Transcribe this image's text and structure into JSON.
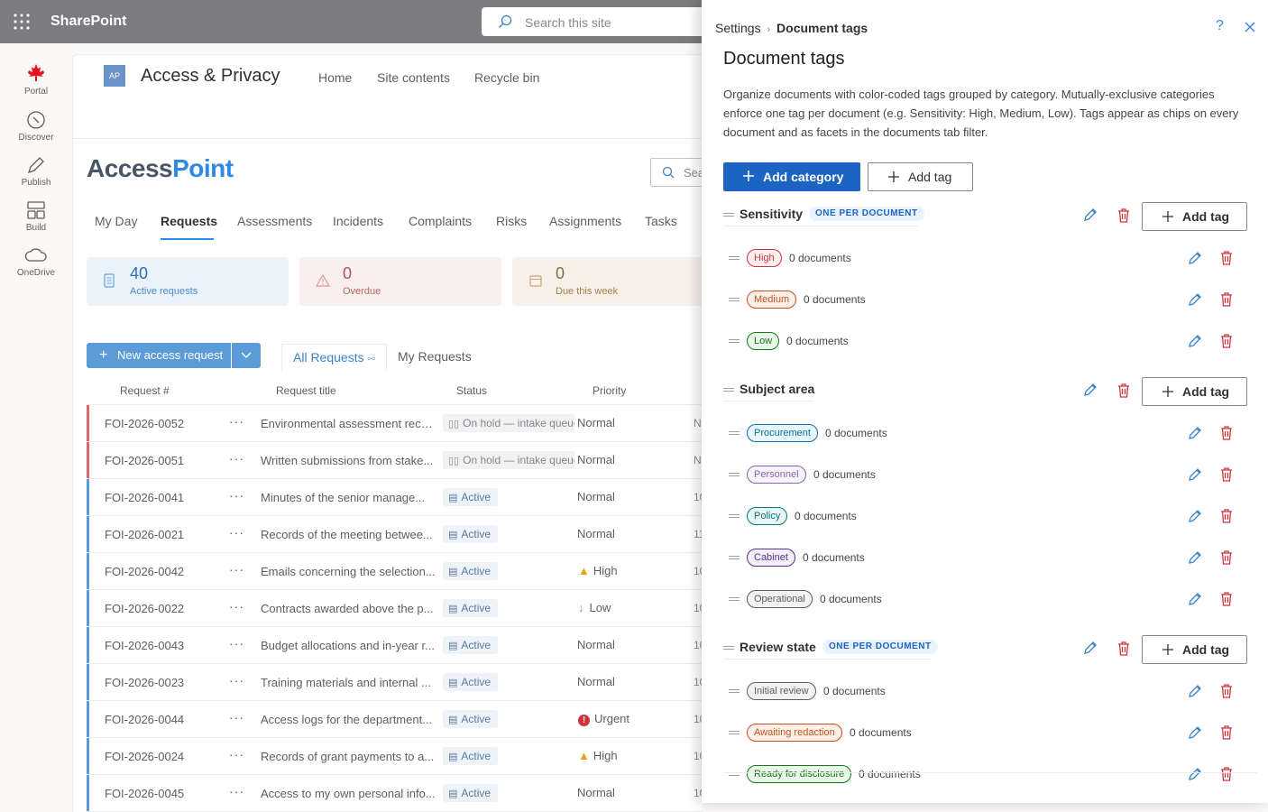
{
  "suite": {
    "brand": "SharePoint",
    "search_placeholder": "Search this site"
  },
  "rail": [
    {
      "label": "Portal",
      "icon": "maple-leaf-icon"
    },
    {
      "label": "Discover",
      "icon": "compass-icon"
    },
    {
      "label": "Publish",
      "icon": "pen-icon"
    },
    {
      "label": "Build",
      "icon": "grid-blocks-icon"
    },
    {
      "label": "OneDrive",
      "icon": "cloud-icon"
    }
  ],
  "site": {
    "logo_text": "AP",
    "name": "Access & Privacy",
    "nav": [
      "Home",
      "Site contents",
      "Recycle bin"
    ],
    "app_logo_a": "Access",
    "app_logo_b": "Point",
    "search_partial": "Sea"
  },
  "tabs": [
    "My Day",
    "Requests",
    "Assessments",
    "Incidents",
    "Complaints",
    "Risks",
    "Assignments",
    "Tasks"
  ],
  "cards": [
    {
      "num": "40",
      "label": "Active requests"
    },
    {
      "num": "0",
      "label": "Overdue"
    },
    {
      "num": "0",
      "label": "Due this week"
    }
  ],
  "actions": {
    "new_request": "New access request",
    "view_all": "All Requests",
    "view_mine": "My Requests"
  },
  "grid": {
    "headers": [
      "Request #",
      "Request title",
      "Status",
      "Priority"
    ],
    "rows": [
      {
        "id": "FOI-2026-0052",
        "title": "Environmental assessment reco...",
        "status": "On hold — intake queue",
        "priority": "Normal",
        "cut": "N"
      },
      {
        "id": "FOI-2026-0051",
        "title": "Written submissions from stake...",
        "status": "On hold — intake queue",
        "priority": "Normal",
        "cut": "N"
      },
      {
        "id": "FOI-2026-0041",
        "title": "Minutes of the senior manage...",
        "status": "Active",
        "priority": "Normal",
        "cut": "10"
      },
      {
        "id": "FOI-2026-0021",
        "title": "Records of the meeting betwee...",
        "status": "Active",
        "priority": "Normal",
        "cut": "11"
      },
      {
        "id": "FOI-2026-0042",
        "title": "Emails concerning the selection...",
        "status": "Active",
        "priority": "High",
        "cut": "10"
      },
      {
        "id": "FOI-2026-0022",
        "title": "Contracts awarded above the p...",
        "status": "Active",
        "priority": "Low",
        "cut": "10"
      },
      {
        "id": "FOI-2026-0043",
        "title": "Budget allocations and in-year r...",
        "status": "Active",
        "priority": "Normal",
        "cut": "10"
      },
      {
        "id": "FOI-2026-0023",
        "title": "Training materials and internal ...",
        "status": "Active",
        "priority": "Normal",
        "cut": "10"
      },
      {
        "id": "FOI-2026-0044",
        "title": "Access logs for the department...",
        "status": "Active",
        "priority": "Urgent",
        "cut": "10"
      },
      {
        "id": "FOI-2026-0024",
        "title": "Records of grant payments to a...",
        "status": "Active",
        "priority": "High",
        "cut": "10"
      },
      {
        "id": "FOI-2026-0045",
        "title": "Access to my own personal info...",
        "status": "Active",
        "priority": "Normal",
        "cut": "10"
      }
    ]
  },
  "panel": {
    "crumb_root": "Settings",
    "crumb_sep": "›",
    "crumb_leaf": "Document tags",
    "help": "?",
    "title": "Document tags",
    "description": "Organize documents with color-coded tags grouped by category. Mutually-exclusive categories enforce one tag per document (e.g. Sensitivity: High, Medium, Low). Tags appear as chips on every document and as facets in the documents tab filter.",
    "add_category": "Add category",
    "add_tag": "Add tag",
    "categories": [
      {
        "name": "Sensitivity",
        "badge": "ONE PER DOCUMENT",
        "tags": [
          {
            "label": "High",
            "count": "0 documents",
            "color": "#d13438"
          },
          {
            "label": "Medium",
            "count": "0 documents",
            "color": "#ca5010"
          },
          {
            "label": "Low",
            "count": "0 documents",
            "color": "#107c10"
          }
        ]
      },
      {
        "name": "Subject area",
        "badge": "",
        "tags": [
          {
            "label": "Procurement",
            "count": "0 documents",
            "color": "#0078a8"
          },
          {
            "label": "Personnel",
            "count": "0 documents",
            "color": "#8764b8"
          },
          {
            "label": "Policy",
            "count": "0 documents",
            "color": "#00787a"
          },
          {
            "label": "Cabinet",
            "count": "0 documents",
            "color": "#5c2e91"
          },
          {
            "label": "Operational",
            "count": "0 documents",
            "color": "#605e5c"
          }
        ]
      },
      {
        "name": "Review state",
        "badge": "ONE PER DOCUMENT",
        "tags": [
          {
            "label": "Initial review",
            "count": "0 documents",
            "color": "#605e5c"
          },
          {
            "label": "Awaiting redaction",
            "count": "0 documents",
            "color": "#ca5010"
          },
          {
            "label": "Ready for disclosure",
            "count": "0 documents",
            "color": "#107c10"
          }
        ]
      }
    ]
  }
}
